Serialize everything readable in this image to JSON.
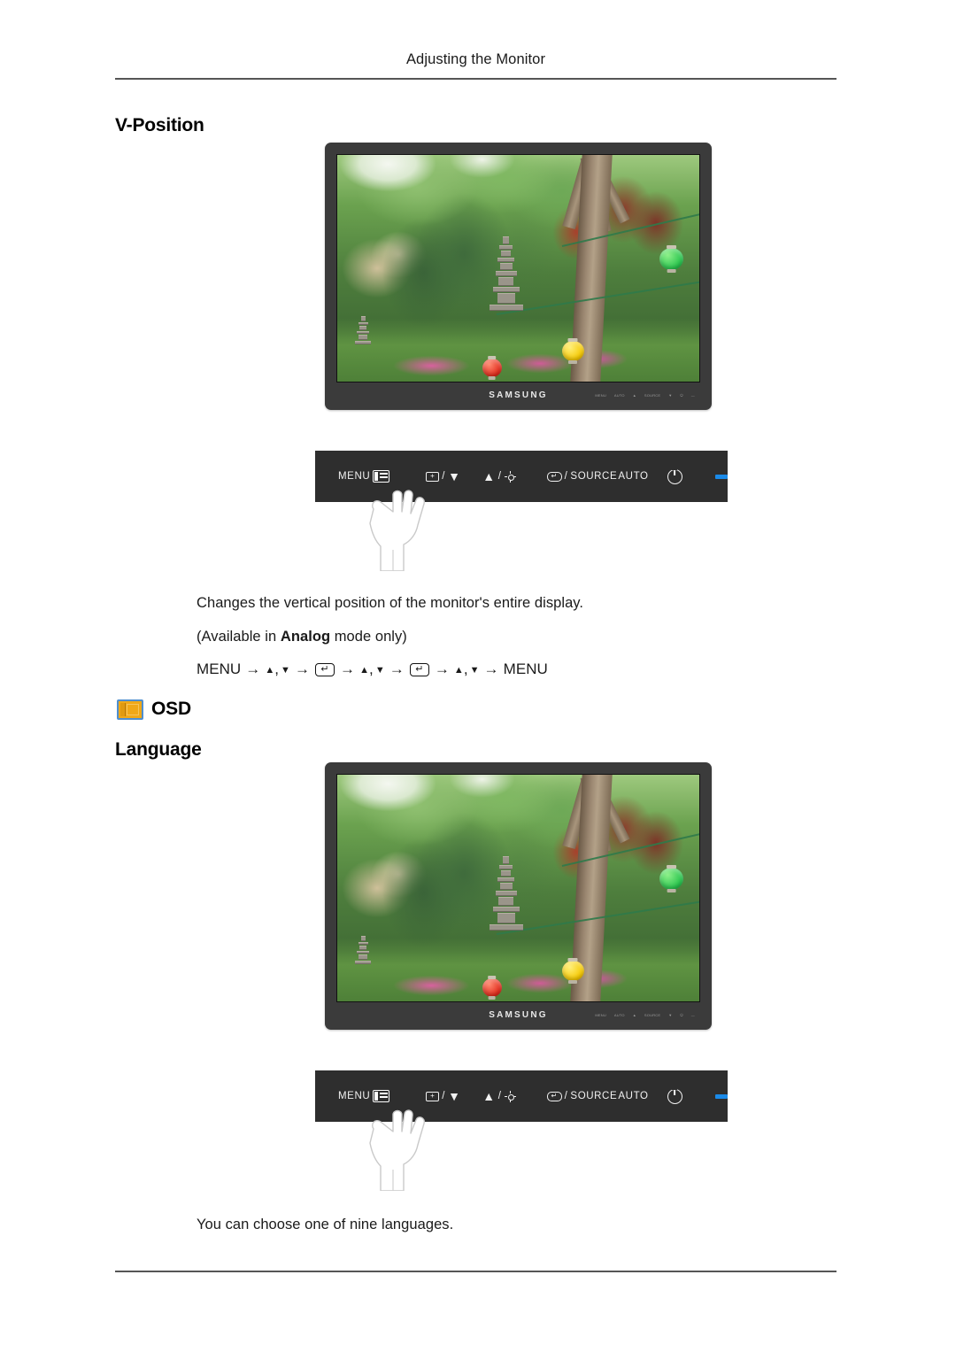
{
  "page": {
    "header_title": "Adjusting the Monitor"
  },
  "sections": [
    {
      "heading": "V-Position",
      "description": "Changes the vertical position of the monitor's entire display.",
      "availability_prefix": "(Available in ",
      "availability_bold": "Analog",
      "availability_suffix": " mode only)",
      "sequence": {
        "start": "MENU",
        "arrow": "→",
        "up": "▲",
        "down": "▼",
        "comma": ",",
        "enter": "↵",
        "end": "MENU"
      }
    },
    {
      "category_icon": "osd-icon",
      "category_label": "OSD",
      "heading": "Language",
      "description": "You can choose one of nine languages."
    }
  ],
  "monitor": {
    "brand": "SAMSUNG",
    "bezel_keys": [
      "MENU",
      "AUTO",
      "▲",
      "SOURCE",
      "▼",
      "⏻",
      "—"
    ],
    "screen_image": "korean-garden-pagoda-photo"
  },
  "control_panel": {
    "buttons": [
      {
        "id": "menu",
        "label": "MENU",
        "icon": "osd-menu-icon"
      },
      {
        "id": "plus-down",
        "label": "/",
        "key_glyph": "⊡",
        "down_glyph": "▼"
      },
      {
        "id": "up-brightness",
        "label": "/",
        "up_glyph": "▲",
        "icon": "brightness-sun-icon"
      },
      {
        "id": "enter-source",
        "label": "/ SOURCE",
        "key_glyph": "↵"
      },
      {
        "id": "auto",
        "label": "AUTO"
      },
      {
        "id": "power",
        "label": "",
        "icon": "power-icon"
      }
    ],
    "led_color": "#1a8ae8",
    "panel_color": "#2e2e2e",
    "source_text": "SOURCE",
    "auto_text": "AUTO",
    "menu_text": "MENU"
  },
  "colors": {
    "accent_blue": "#1a8ae8",
    "bezel": "#3b3b3b",
    "panel": "#2e2e2e",
    "icon_orange": "#f0a818",
    "icon_blue_border": "#4f8fd0",
    "rule": "#555555"
  }
}
